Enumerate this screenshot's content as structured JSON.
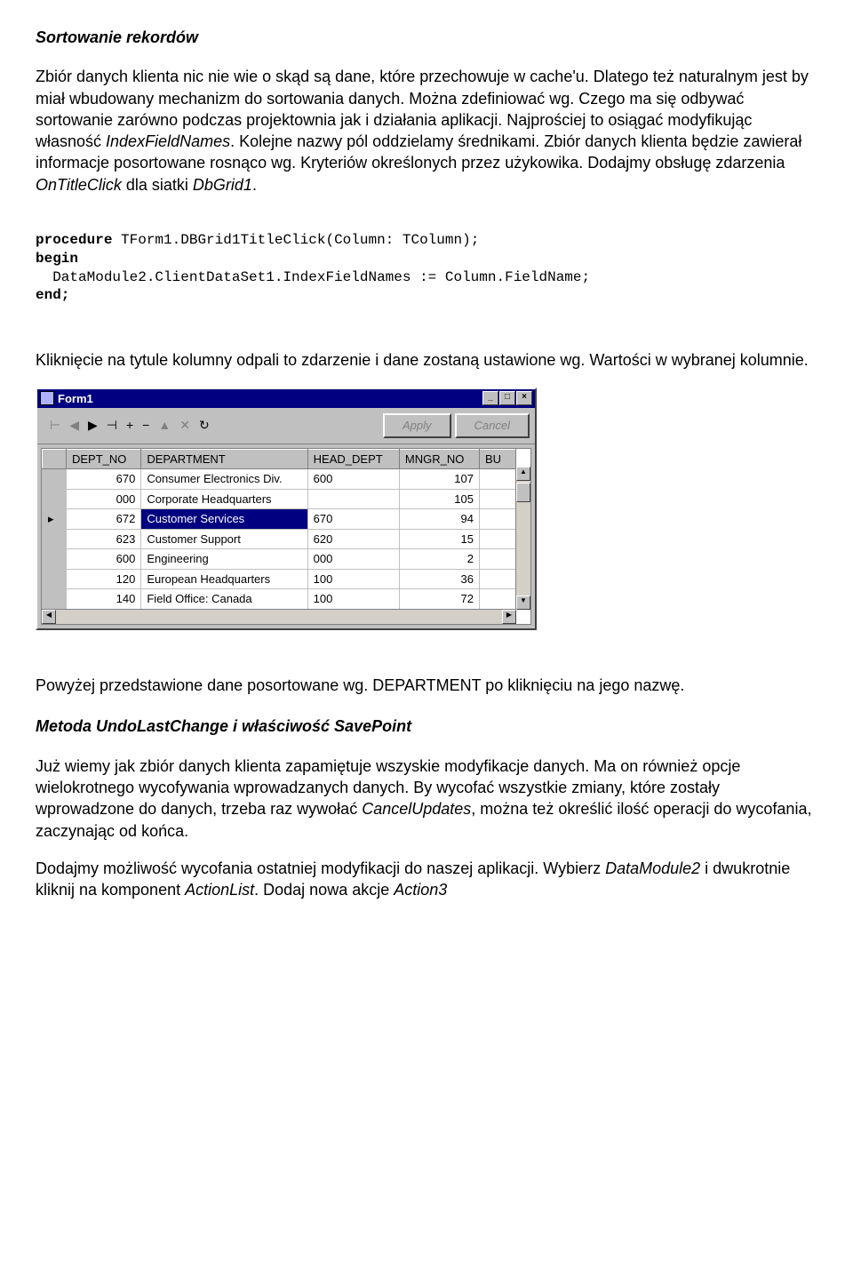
{
  "heading": "Sortowanie rekordów",
  "para1_a": "Zbiór danych klienta nic nie wie o skąd są dane, które przechowuje w cache'u. Dlatego też naturalnym jest by miał wbudowany mechanizm do sortowania danych. Można zdefiniować wg. Czego ma się odbywać sortowanie zarówno podczas projektownia jak i działania aplikacji. Najprościej to osiągać modyfikując własność ",
  "para1_em1": "IndexFieldNames",
  "para1_b": ". Kolejne nazwy pól oddzielamy średnikami. Zbiór danych klienta będzie zawierał informacje posortowane rosnąco wg. Kryteriów określonych przez użykowika. Dodajmy obsługę zdarzenia ",
  "para1_em2": "OnTitleClick",
  "para1_c": " dla siatki ",
  "para1_em3": "DbGrid1",
  "para1_d": ".",
  "code": {
    "l1a": "procedure",
    "l1b": " TForm1.DBGrid1TitleClick(Column: TColumn);",
    "l2": "begin",
    "l3": "  DataModule2.ClientDataSet1.IndexFieldNames := Column.FieldName;",
    "l4": "end;"
  },
  "para2": "Kliknięcie na tytule kolumny odpali to zdarzenie i  dane zostaną ustawione wg. Wartości w wybranej kolumnie.",
  "window": {
    "title": "Form1",
    "apply": "Apply",
    "cancel": "Cancel",
    "columns": [
      "DEPT_NO",
      "DEPARTMENT",
      "HEAD_DEPT",
      "MNGR_NO",
      "BU"
    ],
    "rows": [
      {
        "ind": "",
        "c": [
          "670",
          "Consumer Electronics Div.",
          "600",
          "107",
          ""
        ]
      },
      {
        "ind": "",
        "c": [
          "000",
          "Corporate Headquarters",
          "",
          "105",
          ""
        ]
      },
      {
        "ind": "▸",
        "sel": true,
        "c": [
          "672",
          "Customer Services",
          "670",
          "94",
          ""
        ]
      },
      {
        "ind": "",
        "c": [
          "623",
          "Customer Support",
          "620",
          "15",
          ""
        ]
      },
      {
        "ind": "",
        "c": [
          "600",
          "Engineering",
          "000",
          "2",
          ""
        ]
      },
      {
        "ind": "",
        "c": [
          "120",
          "European Headquarters",
          "100",
          "36",
          ""
        ]
      },
      {
        "ind": "",
        "c": [
          "140",
          "Field Office: Canada",
          "100",
          "72",
          ""
        ]
      }
    ],
    "nav": [
      "⊢",
      "◀",
      "▶",
      "⊣",
      "+",
      "−",
      "▲",
      "✕",
      "↻"
    ]
  },
  "para3": "Powyżej przedstawione dane posortowane wg. DEPARTMENT po kliknięciu na jego nazwę.",
  "heading2": "Metoda UndoLastChange i właściwość SavePoint",
  "para4_a": "Już wiemy jak zbiór danych klienta zapamiętuje wszyskie modyfikacje danych. Ma on również opcje wielokrotnego wycofywania wprowadzanych danych. By wycofać wszystkie zmiany, które zostały wprowadzone do danych, trzeba raz wywołać ",
  "para4_em1": "CancelUpdates",
  "para4_b": ", można też określić ilość operacji do wycofania, zaczynając od końca.",
  "para5_a": "Dodajmy możliwość wycofania ostatniej modyfikacji do naszej aplikacji. Wybierz ",
  "para5_em1": "DataModule2",
  "para5_b": " i dwukrotnie kliknij na komponent ",
  "para5_em2": "ActionList",
  "para5_c": ". Dodaj nowa akcje ",
  "para5_em3": "Action3"
}
